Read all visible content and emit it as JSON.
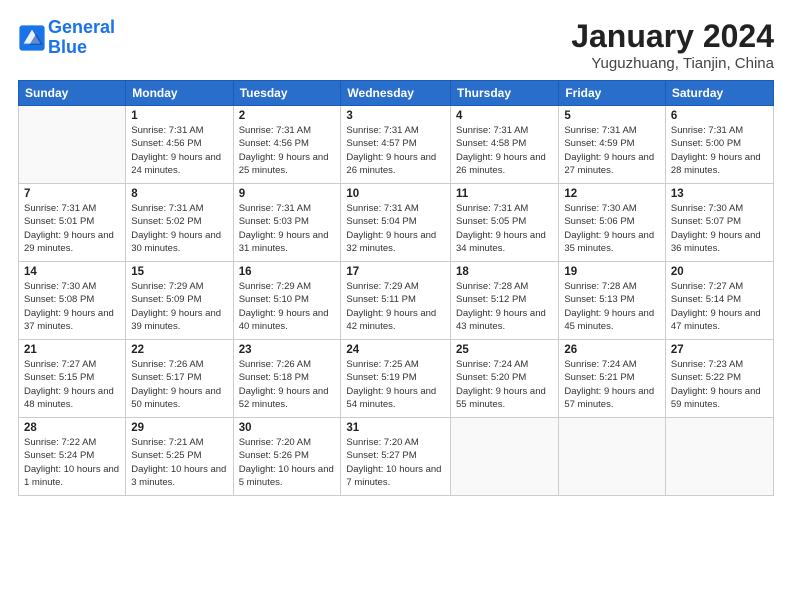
{
  "logo": {
    "line1": "General",
    "line2": "Blue"
  },
  "title": "January 2024",
  "subtitle": "Yuguzhuang, Tianjin, China",
  "weekdays": [
    "Sunday",
    "Monday",
    "Tuesday",
    "Wednesday",
    "Thursday",
    "Friday",
    "Saturday"
  ],
  "weeks": [
    [
      {
        "day": "",
        "sunrise": "",
        "sunset": "",
        "daylight": ""
      },
      {
        "day": "1",
        "sunrise": "Sunrise: 7:31 AM",
        "sunset": "Sunset: 4:56 PM",
        "daylight": "Daylight: 9 hours and 24 minutes."
      },
      {
        "day": "2",
        "sunrise": "Sunrise: 7:31 AM",
        "sunset": "Sunset: 4:56 PM",
        "daylight": "Daylight: 9 hours and 25 minutes."
      },
      {
        "day": "3",
        "sunrise": "Sunrise: 7:31 AM",
        "sunset": "Sunset: 4:57 PM",
        "daylight": "Daylight: 9 hours and 26 minutes."
      },
      {
        "day": "4",
        "sunrise": "Sunrise: 7:31 AM",
        "sunset": "Sunset: 4:58 PM",
        "daylight": "Daylight: 9 hours and 26 minutes."
      },
      {
        "day": "5",
        "sunrise": "Sunrise: 7:31 AM",
        "sunset": "Sunset: 4:59 PM",
        "daylight": "Daylight: 9 hours and 27 minutes."
      },
      {
        "day": "6",
        "sunrise": "Sunrise: 7:31 AM",
        "sunset": "Sunset: 5:00 PM",
        "daylight": "Daylight: 9 hours and 28 minutes."
      }
    ],
    [
      {
        "day": "7",
        "sunrise": "Sunrise: 7:31 AM",
        "sunset": "Sunset: 5:01 PM",
        "daylight": "Daylight: 9 hours and 29 minutes."
      },
      {
        "day": "8",
        "sunrise": "Sunrise: 7:31 AM",
        "sunset": "Sunset: 5:02 PM",
        "daylight": "Daylight: 9 hours and 30 minutes."
      },
      {
        "day": "9",
        "sunrise": "Sunrise: 7:31 AM",
        "sunset": "Sunset: 5:03 PM",
        "daylight": "Daylight: 9 hours and 31 minutes."
      },
      {
        "day": "10",
        "sunrise": "Sunrise: 7:31 AM",
        "sunset": "Sunset: 5:04 PM",
        "daylight": "Daylight: 9 hours and 32 minutes."
      },
      {
        "day": "11",
        "sunrise": "Sunrise: 7:31 AM",
        "sunset": "Sunset: 5:05 PM",
        "daylight": "Daylight: 9 hours and 34 minutes."
      },
      {
        "day": "12",
        "sunrise": "Sunrise: 7:30 AM",
        "sunset": "Sunset: 5:06 PM",
        "daylight": "Daylight: 9 hours and 35 minutes."
      },
      {
        "day": "13",
        "sunrise": "Sunrise: 7:30 AM",
        "sunset": "Sunset: 5:07 PM",
        "daylight": "Daylight: 9 hours and 36 minutes."
      }
    ],
    [
      {
        "day": "14",
        "sunrise": "Sunrise: 7:30 AM",
        "sunset": "Sunset: 5:08 PM",
        "daylight": "Daylight: 9 hours and 37 minutes."
      },
      {
        "day": "15",
        "sunrise": "Sunrise: 7:29 AM",
        "sunset": "Sunset: 5:09 PM",
        "daylight": "Daylight: 9 hours and 39 minutes."
      },
      {
        "day": "16",
        "sunrise": "Sunrise: 7:29 AM",
        "sunset": "Sunset: 5:10 PM",
        "daylight": "Daylight: 9 hours and 40 minutes."
      },
      {
        "day": "17",
        "sunrise": "Sunrise: 7:29 AM",
        "sunset": "Sunset: 5:11 PM",
        "daylight": "Daylight: 9 hours and 42 minutes."
      },
      {
        "day": "18",
        "sunrise": "Sunrise: 7:28 AM",
        "sunset": "Sunset: 5:12 PM",
        "daylight": "Daylight: 9 hours and 43 minutes."
      },
      {
        "day": "19",
        "sunrise": "Sunrise: 7:28 AM",
        "sunset": "Sunset: 5:13 PM",
        "daylight": "Daylight: 9 hours and 45 minutes."
      },
      {
        "day": "20",
        "sunrise": "Sunrise: 7:27 AM",
        "sunset": "Sunset: 5:14 PM",
        "daylight": "Daylight: 9 hours and 47 minutes."
      }
    ],
    [
      {
        "day": "21",
        "sunrise": "Sunrise: 7:27 AM",
        "sunset": "Sunset: 5:15 PM",
        "daylight": "Daylight: 9 hours and 48 minutes."
      },
      {
        "day": "22",
        "sunrise": "Sunrise: 7:26 AM",
        "sunset": "Sunset: 5:17 PM",
        "daylight": "Daylight: 9 hours and 50 minutes."
      },
      {
        "day": "23",
        "sunrise": "Sunrise: 7:26 AM",
        "sunset": "Sunset: 5:18 PM",
        "daylight": "Daylight: 9 hours and 52 minutes."
      },
      {
        "day": "24",
        "sunrise": "Sunrise: 7:25 AM",
        "sunset": "Sunset: 5:19 PM",
        "daylight": "Daylight: 9 hours and 54 minutes."
      },
      {
        "day": "25",
        "sunrise": "Sunrise: 7:24 AM",
        "sunset": "Sunset: 5:20 PM",
        "daylight": "Daylight: 9 hours and 55 minutes."
      },
      {
        "day": "26",
        "sunrise": "Sunrise: 7:24 AM",
        "sunset": "Sunset: 5:21 PM",
        "daylight": "Daylight: 9 hours and 57 minutes."
      },
      {
        "day": "27",
        "sunrise": "Sunrise: 7:23 AM",
        "sunset": "Sunset: 5:22 PM",
        "daylight": "Daylight: 9 hours and 59 minutes."
      }
    ],
    [
      {
        "day": "28",
        "sunrise": "Sunrise: 7:22 AM",
        "sunset": "Sunset: 5:24 PM",
        "daylight": "Daylight: 10 hours and 1 minute."
      },
      {
        "day": "29",
        "sunrise": "Sunrise: 7:21 AM",
        "sunset": "Sunset: 5:25 PM",
        "daylight": "Daylight: 10 hours and 3 minutes."
      },
      {
        "day": "30",
        "sunrise": "Sunrise: 7:20 AM",
        "sunset": "Sunset: 5:26 PM",
        "daylight": "Daylight: 10 hours and 5 minutes."
      },
      {
        "day": "31",
        "sunrise": "Sunrise: 7:20 AM",
        "sunset": "Sunset: 5:27 PM",
        "daylight": "Daylight: 10 hours and 7 minutes."
      },
      {
        "day": "",
        "sunrise": "",
        "sunset": "",
        "daylight": ""
      },
      {
        "day": "",
        "sunrise": "",
        "sunset": "",
        "daylight": ""
      },
      {
        "day": "",
        "sunrise": "",
        "sunset": "",
        "daylight": ""
      }
    ]
  ]
}
